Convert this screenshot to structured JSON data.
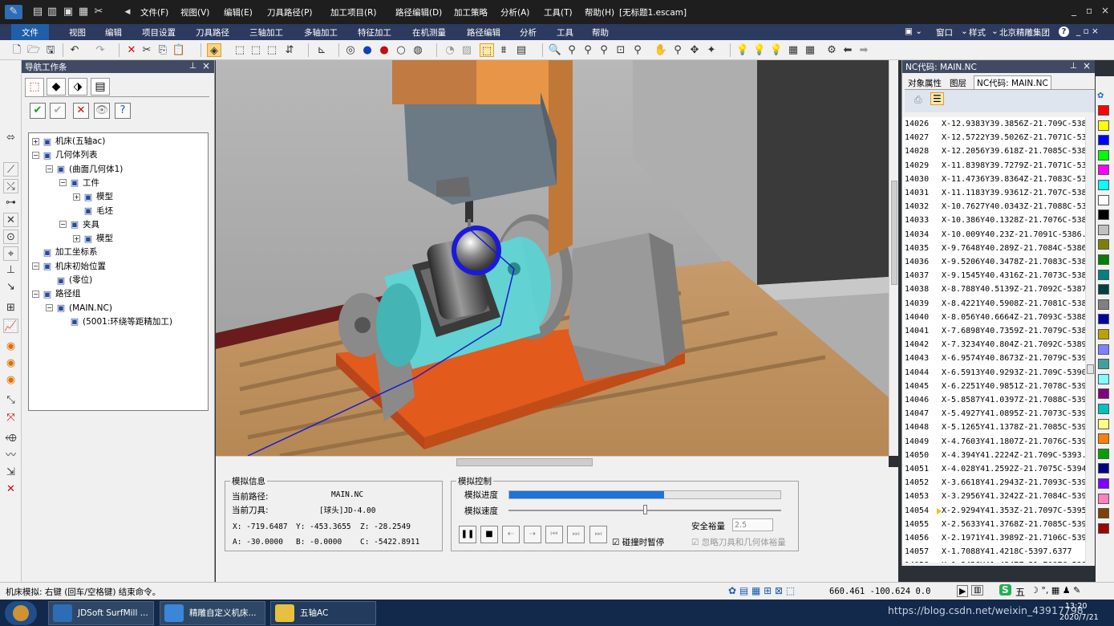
{
  "window": {
    "menu": [
      "文件(F)",
      "视图(V)",
      "编辑(E)",
      "刀具路径(P)",
      "加工项目(R)",
      "路径编辑(D)",
      "加工策略",
      "分析(A)",
      "工具(T)",
      "帮助(H)"
    ],
    "doc_title": "[无标题1.escam]",
    "controls": [
      "_",
      "▫",
      "×"
    ]
  },
  "ribbon": {
    "tabs": [
      "文件",
      "视图",
      "编辑",
      "项目设置",
      "刀具路径",
      "三轴加工",
      "多轴加工",
      "特征加工",
      "在机测量",
      "路径编辑",
      "分析",
      "工具",
      "帮助"
    ],
    "right": [
      "窗口",
      "样式",
      "北京精雕集团"
    ]
  },
  "nav_panel": {
    "title": "导航工作条",
    "tree": [
      {
        "label": "机床(五轴ac)",
        "level": 0,
        "expander": "⊞",
        "icon": "machine-icon"
      },
      {
        "label": "几何体列表",
        "level": 0,
        "expander": "⊟",
        "icon": "geometry-list-icon"
      },
      {
        "label": "(曲面几何体1)",
        "level": 1,
        "expander": "⊟",
        "icon": "surface-geometry-icon"
      },
      {
        "label": "工件",
        "level": 2,
        "expander": "⊟",
        "icon": "workpiece-icon"
      },
      {
        "label": "模型",
        "level": 3,
        "expander": "⊞",
        "icon": "model-icon"
      },
      {
        "label": "毛坯",
        "level": 3,
        "expander": "",
        "icon": "blank-icon"
      },
      {
        "label": "夹具",
        "level": 2,
        "expander": "⊟",
        "icon": "fixture-icon"
      },
      {
        "label": "模型",
        "level": 3,
        "expander": "⊞",
        "icon": "model-icon"
      },
      {
        "label": "加工坐标系",
        "level": 0,
        "expander": "",
        "icon": "coordinate-icon"
      },
      {
        "label": "机床初始位置",
        "level": 0,
        "expander": "⊟",
        "icon": "machine-home-icon"
      },
      {
        "label": "(零位)",
        "level": 1,
        "expander": "",
        "icon": "zero-position-icon"
      },
      {
        "label": "路径组",
        "level": 0,
        "expander": "⊟",
        "icon": "path-group-icon"
      },
      {
        "label": "(MAIN.NC)",
        "level": 1,
        "expander": "⊟",
        "icon": "nc-file-icon"
      },
      {
        "label": "(5001:环绕等距精加工)",
        "level": 2,
        "expander": "",
        "icon": "toolpath-icon"
      }
    ]
  },
  "sim_info": {
    "legend": "模拟信息",
    "current_path_label": "当前路径:",
    "current_path": "MAIN.NC",
    "current_tool_label": "当前刀具:",
    "current_tool": "[球头]JD-4.00",
    "x": "X: -719.6487",
    "y": "Y: -453.3655",
    "z": "Z: -28.2549",
    "a": "A: -30.0000",
    "b": "B: -0.0000",
    "c": "C: -5422.8911"
  },
  "sim_control": {
    "legend": "模拟控制",
    "progress_label": "模拟进度",
    "progress": 0.57,
    "speed_label": "模拟速度",
    "speed": 0.5,
    "safety_label": "安全裕量",
    "safety_value": "2.5",
    "pause_on_collision": "碰撞时暂停",
    "ignore_label": "忽略刀具和几何体裕量"
  },
  "nc_panel": {
    "title": "NC代码: MAIN.NC",
    "tabs": [
      "对象属性",
      "图层",
      "NC代码: MAIN.NC"
    ],
    "lines": [
      [
        "14026",
        "X-12.9383Y39.3856Z-21.709C-5381"
      ],
      [
        "14027",
        "X-12.5722Y39.5026Z-21.7071C-538"
      ],
      [
        "14028",
        "X-12.2056Y39.618Z-21.7085C-5382"
      ],
      [
        "14029",
        "X-11.8398Y39.7279Z-21.7071C-538"
      ],
      [
        "14030",
        "X-11.4736Y39.8364Z-21.7083C-538"
      ],
      [
        "14031",
        "X-11.1183Y39.9361Z-21.707C-5384"
      ],
      [
        "14032",
        "X-10.7627Y40.0343Z-21.7088C-538"
      ],
      [
        "14033",
        "X-10.386Y40.1328Z-21.7076C-5385"
      ],
      [
        "14034",
        "X-10.009Y40.23Z-21.7091C-5386.0"
      ],
      [
        "14035",
        "X-9.7648Y40.289Z-21.7084C-5386.3"
      ],
      [
        "14036",
        "X-9.5206Y40.3478Z-21.7083C-5386"
      ],
      [
        "14037",
        "X-9.1545Y40.4316Z-21.7073C-5387"
      ],
      [
        "14038",
        "X-8.788Y40.5139Z-21.7092C-5387.7"
      ],
      [
        "14039",
        "X-8.4221Y40.5908Z-21.7081C-5388"
      ],
      [
        "14040",
        "X-8.056Y40.6664Z-21.7093C-5388.7"
      ],
      [
        "14041",
        "X-7.6898Y40.7359Z-21.7079C-5389"
      ],
      [
        "14042",
        "X-7.3234Y40.804Z-21.7092C-5389.8"
      ],
      [
        "14043",
        "X-6.9574Y40.8673Z-21.7079C-5390"
      ],
      [
        "14044",
        "X-6.5913Y40.9293Z-21.709C-5390.8"
      ],
      [
        "14045",
        "X-6.2251Y40.9851Z-21.7078C-5391"
      ],
      [
        "14046",
        "X-5.8587Y41.0397Z-21.7088C-5391"
      ],
      [
        "14047",
        "X-5.4927Y41.0895Z-21.7073C-5392"
      ],
      [
        "14048",
        "X-5.1265Y41.1378Z-21.7085C-5392"
      ],
      [
        "14049",
        "X-4.7603Y41.1807Z-21.7076C-5393"
      ],
      [
        "14050",
        "X-4.394Y41.2224Z-21.709C-5393.9"
      ],
      [
        "14051",
        "X-4.028Y41.2592Z-21.7075C-5394.4"
      ],
      [
        "14052",
        "X-3.6618Y41.2943Z-21.7093C-5394"
      ],
      [
        "14053",
        "X-3.2956Y41.3242Z-21.7084C-5395"
      ],
      [
        "14054",
        "X-2.9294Y41.353Z-21.7097C-5395.9"
      ],
      [
        "14055",
        "X-2.5633Y41.3768Z-21.7085C-5396"
      ],
      [
        "14056",
        "X-2.1971Y41.3989Z-21.7106C-5396"
      ],
      [
        "14057",
        "X-1.7088Y41.4218C-5397.6377"
      ],
      [
        "14058",
        "X-1.3426Y41.4347Z-21.7097C-5398"
      ],
      [
        "14059",
        "X-0.9764Y41.4464Z-21.7111C-5398"
      ],
      [
        "14060",
        "X-0.6103Y41.4525Z-21.7101C-5399"
      ],
      [
        "14061",
        "X-0.2441Y41.4571Z-21.7118C-5399"
      ],
      [
        "14062",
        "X0.1221Y41.4563Z-21.7095C-5400."
      ],
      [
        "14063",
        "X0.4882Y41.4542Z-21.7097C-5400."
      ]
    ],
    "current_line": "14054"
  },
  "palette": [
    "#ff0000",
    "#ffff00",
    "#0000ff",
    "#00ff00",
    "#ff00ff",
    "#00ffff",
    "#ffffff",
    "#000000",
    "#c0c0c0",
    "#808000",
    "#008000",
    "#008080",
    "#004040",
    "#808080",
    "#0000a0",
    "#c0a000",
    "#8080ff",
    "#40a0a0",
    "#80ffff",
    "#800080",
    "#00c0c0",
    "#ffff80",
    "#ff8000",
    "#00a000",
    "#000080",
    "#8000ff",
    "#ff80c0",
    "#804000",
    "#a00000"
  ],
  "status": {
    "message": "机床模拟: 右键 (回车/空格键) 结束命令。",
    "coords": "660.461 -100.624 0.0",
    "ime": "五",
    "watermark": "https://blog.csdn.net/weixin_43917798",
    "time": "13:20",
    "date": "2020/7/21"
  },
  "taskbar": {
    "items": [
      "JDSoft SurfMill ...",
      "精雕自定义机床...",
      "五轴AC"
    ]
  }
}
